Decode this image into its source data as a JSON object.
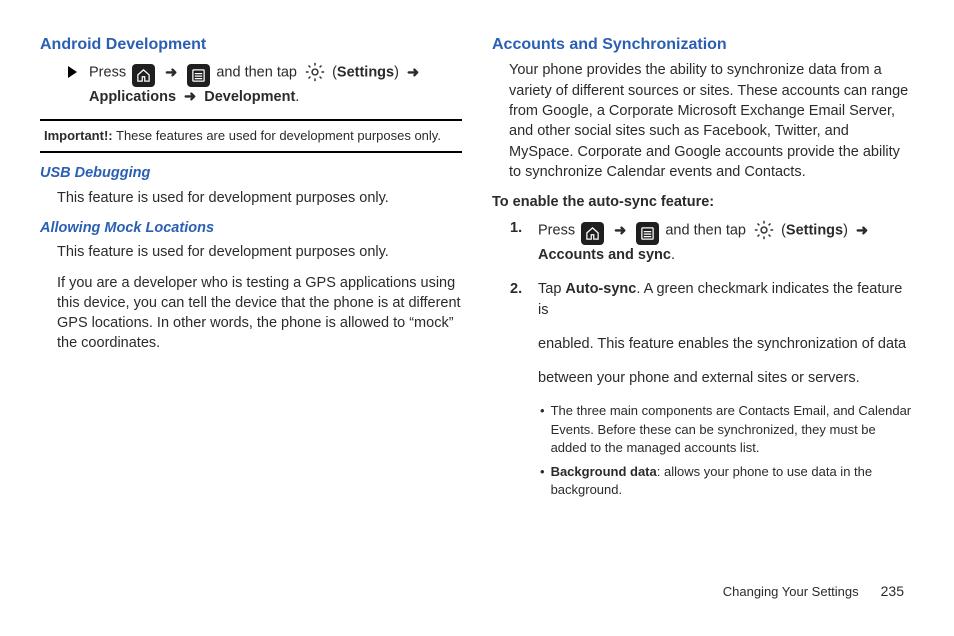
{
  "left": {
    "h_android_dev": "Android Development",
    "step_press": "Press",
    "step_andthentap": "and then tap",
    "settings_label": "Settings",
    "applications": "Applications",
    "development": "Development",
    "important_label": "Important!:",
    "important_text": "These features are used for development purposes only.",
    "h_usb": "USB Debugging",
    "usb_text": "This feature is used for development purposes only.",
    "h_mock": "Allowing Mock Locations",
    "mock_p1": "This feature is used for development purposes only.",
    "mock_p2": "If you are a developer who is testing a GPS applications using this device, you can tell the device that the phone is at different GPS locations. In other words, the phone is allowed to “mock” the coordinates."
  },
  "right": {
    "h_accounts": "Accounts and Synchronization",
    "intro": "Your phone provides the ability to synchronize data from a variety of different sources or sites. These accounts can range from Google, a Corporate Microsoft Exchange Email Server, and other social sites such as Facebook, Twitter, and MySpace. Corporate and Google accounts provide the ability to synchronize Calendar events and Contacts.",
    "enable_heading": "To enable the auto-sync feature:",
    "step1_press": "Press",
    "step1_andthentap": "and then tap",
    "settings_label": "Settings",
    "accounts_sync": "Accounts and sync",
    "step2_tap": "Tap",
    "autosync": "Auto-sync",
    "step2_rest1": ". A green checkmark indicates the feature is",
    "step2_line2": "enabled. This feature enables the synchronization of data",
    "step2_line3": "between your phone and external sites or servers.",
    "bullet1": "The three main components are Contacts Email, and Calendar Events. Before these can be synchronized, they must be added to the managed accounts list.",
    "bullet2_label": "Background data",
    "bullet2_rest": ": allows your phone to use data in the background."
  },
  "footer": {
    "section": "Changing Your Settings",
    "page": "235"
  },
  "glyphs": {
    "arrow": "➜",
    "bullet": "•"
  }
}
